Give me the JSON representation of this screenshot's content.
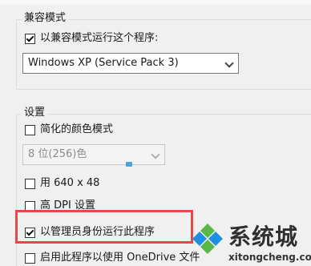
{
  "compat_group": {
    "title": "兼容模式",
    "checkbox_label": "以兼容模式运行这个程序:",
    "checkbox_checked": true,
    "os_select": {
      "selected": "Windows XP (Service Pack 3)"
    }
  },
  "settings_group": {
    "title": "设置",
    "reduced_color": {
      "label": "简化的颜色模式",
      "checked": false
    },
    "color_select": {
      "selected": "8 位(256)色"
    },
    "resolution": {
      "label": "用 640 x 48",
      "checked": false
    },
    "dpi": {
      "label": "高 DPI 设置",
      "checked": false
    },
    "run_as_admin": {
      "label": "以管理员身份运行此程序",
      "checked": true
    },
    "onedrive": {
      "label": "启用此程序以使用 OneDrive 文件",
      "checked": false
    }
  },
  "watermark": {
    "brand": "系统城",
    "url": "xitongcheng.com",
    "logo": "pinwheel-logo-icon"
  },
  "colors": {
    "highlight_border": "#e64848",
    "logo_blue": "#1f8fe0",
    "logo_green": "#58b947"
  }
}
